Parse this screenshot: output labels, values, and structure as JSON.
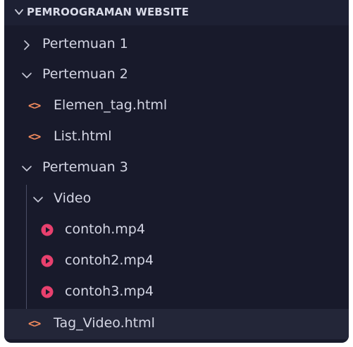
{
  "explorer": {
    "section_title": "PEMROOGRAMAN WEBSITE",
    "items": [
      {
        "label": "Pertemuan 1",
        "kind": "folder",
        "expanded": false
      },
      {
        "label": "Pertemuan 2",
        "kind": "folder",
        "expanded": true
      },
      {
        "label": "Elemen_tag.html",
        "kind": "html-file"
      },
      {
        "label": "List.html",
        "kind": "html-file"
      },
      {
        "label": "Pertemuan 3",
        "kind": "folder",
        "expanded": true
      },
      {
        "label": "Video",
        "kind": "folder",
        "expanded": true
      },
      {
        "label": "contoh.mp4",
        "kind": "video-file"
      },
      {
        "label": "contoh2.mp4",
        "kind": "video-file"
      },
      {
        "label": "contoh3.mp4",
        "kind": "video-file"
      },
      {
        "label": "Tag_Video.html",
        "kind": "html-file",
        "selected": true
      }
    ],
    "html_icon_glyph": "<>",
    "colors": {
      "background": "#181a2b",
      "header": "#1d2033",
      "selected_row": "#232638",
      "html_icon": "#f08a5d",
      "video_icon": "#e8406e",
      "text": "#d4d6e4"
    }
  }
}
